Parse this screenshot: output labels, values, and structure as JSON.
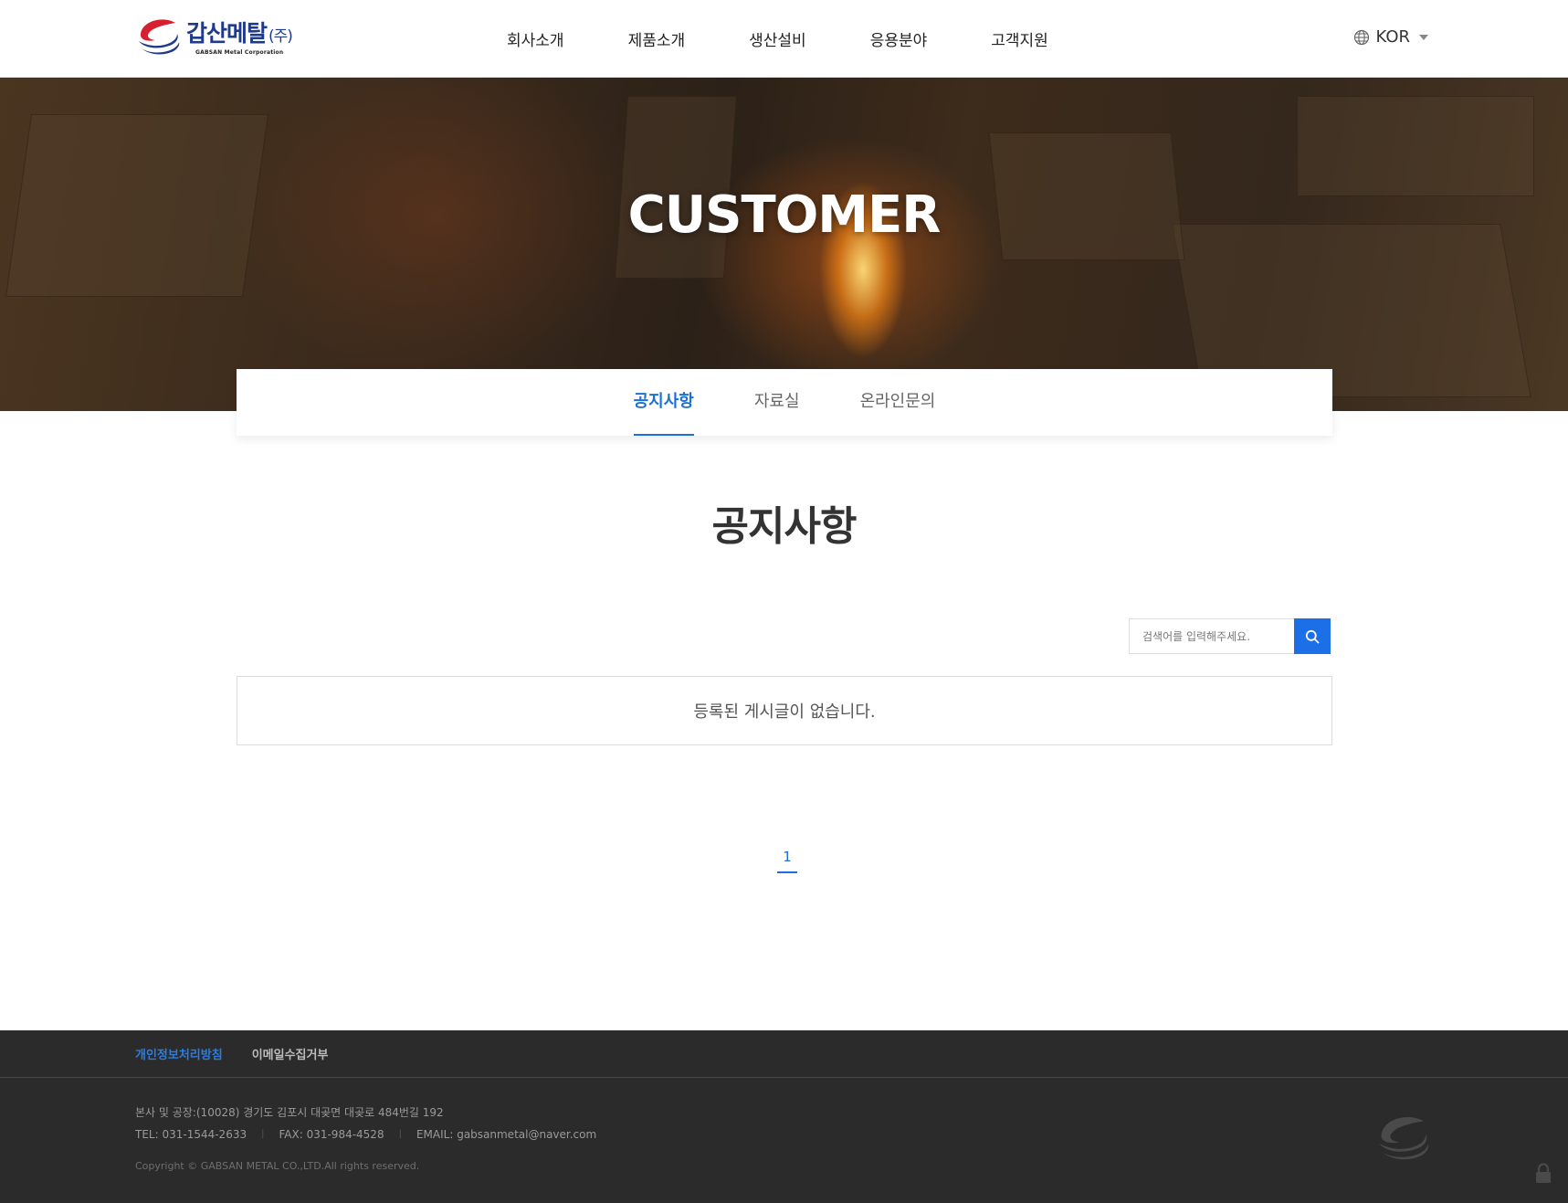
{
  "header": {
    "logo": {
      "kor": "갑산메탈",
      "suffix": "(주)",
      "eng": "GABSAN Metal Corporation",
      "colors": {
        "red": "#d62030",
        "navy": "#1f3a8a"
      }
    },
    "nav": [
      "회사소개",
      "제품소개",
      "생산설비",
      "응용분야",
      "고객지원"
    ],
    "language": {
      "label": "KOR",
      "icon": "globe-icon"
    }
  },
  "hero": {
    "title": "CUSTOMER"
  },
  "subnav": {
    "tabs": [
      "공지사항",
      "자료실",
      "온라인문의"
    ],
    "active": "공지사항"
  },
  "main": {
    "title": "공지사항",
    "search": {
      "placeholder": "검색어를 입력해주세요.",
      "value": "",
      "icon": "search-icon"
    },
    "empty_message": "등록된 게시글이 없습니다.",
    "pagination": {
      "current": "1"
    }
  },
  "footer": {
    "links": [
      "개인정보처리방침",
      "이메일수집거부"
    ],
    "address": "본사 및 공장:(10028) 경기도 김포시 대곶면 대곶로 484번길 192",
    "tel": "TEL: 031-1544-2633",
    "fax": "FAX: 031-984-4528",
    "email": "EMAIL: gabsanmetal@naver.com",
    "copyright": "Copyright © GABSAN METAL CO.,LTD.All rights reserved."
  },
  "colors": {
    "accent": "#1d6fd8",
    "search_button": "#1d6fe8",
    "footer_bg": "#2b2b2b"
  }
}
